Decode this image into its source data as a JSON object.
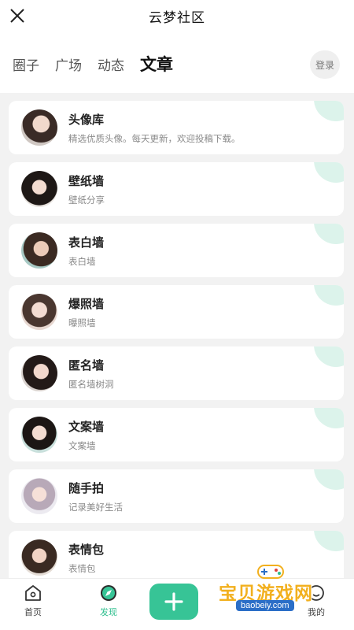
{
  "header": {
    "title": "云梦社区",
    "close_icon": "close-icon"
  },
  "tabs": [
    {
      "label": "圈子",
      "active": false
    },
    {
      "label": "广场",
      "active": false
    },
    {
      "label": "动态",
      "active": false
    },
    {
      "label": "文章",
      "active": true
    }
  ],
  "login_label": "登录",
  "accent_color": "#37c496",
  "items": [
    {
      "title": "头像库",
      "desc": "精选优质头像。每天更新，欢迎投稿下载。"
    },
    {
      "title": "壁纸墙",
      "desc": "壁纸分享"
    },
    {
      "title": "表白墙",
      "desc": "表白墙"
    },
    {
      "title": "爆照墙",
      "desc": "曝照墙"
    },
    {
      "title": "匿名墙",
      "desc": "匿名墙树洞"
    },
    {
      "title": "文案墙",
      "desc": "文案墙"
    },
    {
      "title": "随手拍",
      "desc": "记录美好生活"
    },
    {
      "title": "表情包",
      "desc": "表情包"
    }
  ],
  "nav": {
    "home": {
      "label": "首页",
      "icon": "home-icon"
    },
    "discover": {
      "label": "发现",
      "icon": "compass-icon",
      "active": true
    },
    "add": {
      "icon": "plus-icon"
    },
    "mine": {
      "label": "我的",
      "icon": "user-icon"
    }
  },
  "watermark": {
    "text": "宝贝游戏网",
    "url": "baobeiy.com"
  }
}
